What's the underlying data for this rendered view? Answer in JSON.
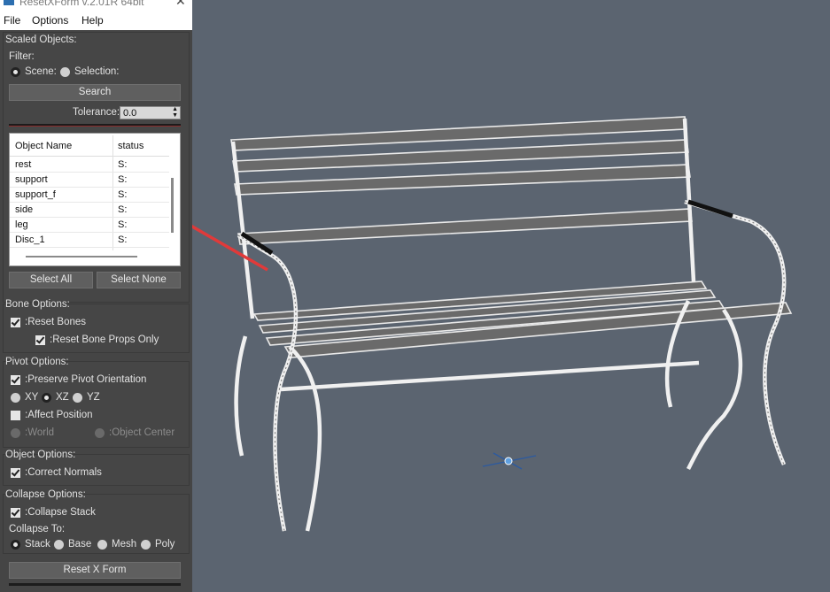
{
  "window": {
    "title": "ResetXForm v.2.01R 64bit",
    "close": "✕"
  },
  "menu": [
    "File",
    "Options",
    "Help"
  ],
  "scaled": {
    "header": "Scaled Objects:",
    "filter_label": "Filter:",
    "scene_label": "Scene:",
    "selection_label": "Selection:",
    "search_label": "Search",
    "tolerance_label": "Tolerance:",
    "tolerance_value": "0.0",
    "columns": [
      "Object Name",
      "status"
    ],
    "rows": [
      {
        "name": "rest",
        "status": "S:"
      },
      {
        "name": "support",
        "status": "S:"
      },
      {
        "name": "support_f",
        "status": "S:"
      },
      {
        "name": "side",
        "status": "S:"
      },
      {
        "name": "leg",
        "status": "S:"
      },
      {
        "name": "Disc_1",
        "status": "S:"
      }
    ],
    "select_all": "Select All",
    "select_none": "Select None"
  },
  "bone": {
    "header": "Bone Options:",
    "reset_bones": ":Reset Bones",
    "reset_props": ":Reset Bone Props Only"
  },
  "pivot": {
    "header": "Pivot Options:",
    "preserve": ":Preserve Pivot Orientation",
    "xy": "XY",
    "xz": "XZ",
    "yz": "YZ",
    "affect": ":Affect Position",
    "world": ":World",
    "center": ":Object Center"
  },
  "object": {
    "header": "Object Options:",
    "normals": ":Correct Normals"
  },
  "collapse": {
    "header": "Collapse Options:",
    "stack": ":Collapse Stack",
    "to_label": "Collapse To:",
    "opt_stack": "Stack",
    "opt_base": "Base",
    "opt_mesh": "Mesh",
    "opt_poly": "Poly"
  },
  "reset_button": "Reset X Form",
  "colors": {
    "panel": "#454545",
    "viewport": "#5b6470",
    "arrow": "#e03a3a"
  }
}
